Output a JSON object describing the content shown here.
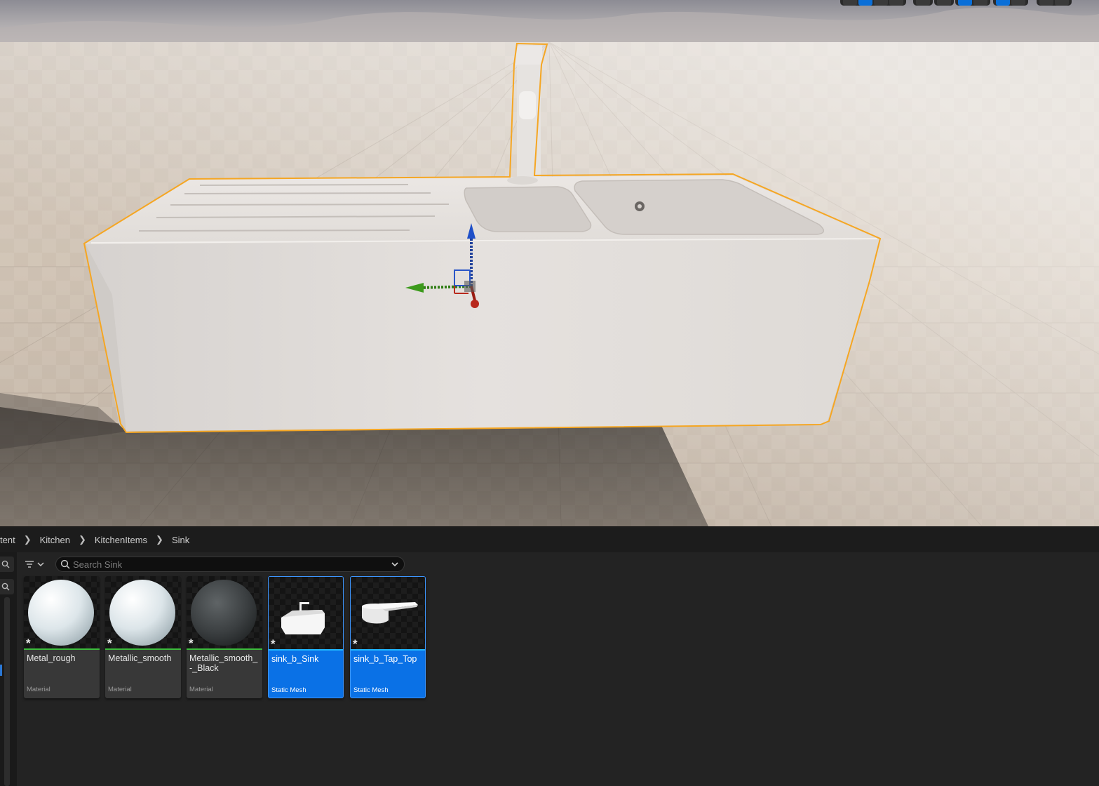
{
  "breadcrumb": {
    "items": [
      "tent",
      "Kitchen",
      "KitchenItems",
      "Sink"
    ]
  },
  "search": {
    "placeholder": "Search Sink",
    "value": ""
  },
  "assets": [
    {
      "name": "Metal_rough",
      "type": "Material",
      "selected": false,
      "thumbnail": "white-sphere"
    },
    {
      "name": "Metallic_smooth",
      "type": "Material",
      "selected": false,
      "thumbnail": "white-sphere"
    },
    {
      "name": "Metallic_smooth_-_Black",
      "type": "Material",
      "selected": false,
      "thumbnail": "black-sphere"
    },
    {
      "name": "sink_b_Sink",
      "type": "Static Mesh",
      "selected": true,
      "thumbnail": "sink-mesh"
    },
    {
      "name": "sink_b_Tap_Top",
      "type": "Static Mesh",
      "selected": true,
      "thumbnail": "tap-mesh"
    }
  ],
  "modified_marker": "*",
  "colors": {
    "selection_outline": "#f5a623",
    "selected_tile": "#0a71e6",
    "material_line": "#3cbc3c",
    "mesh_line": "#22b8ff",
    "gizmo_x": "#c0281c",
    "gizmo_y": "#3c9a1c",
    "gizmo_z": "#1e4fc8"
  }
}
